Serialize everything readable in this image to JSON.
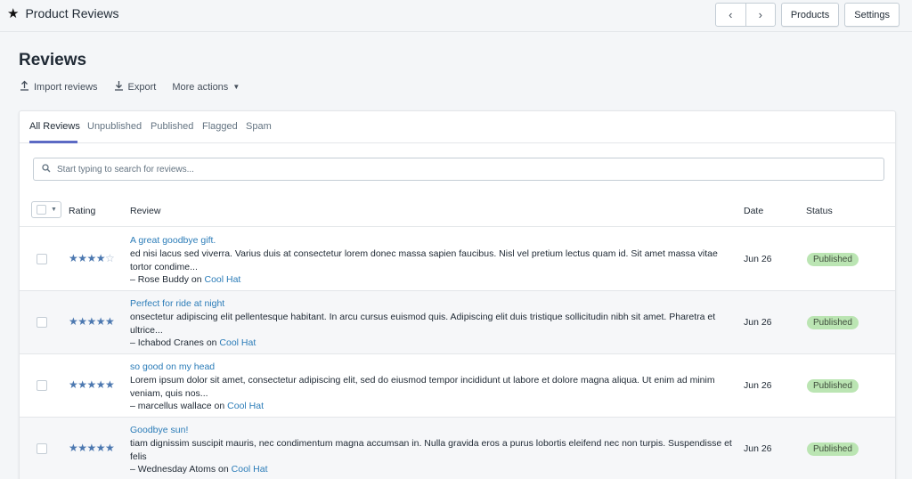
{
  "header": {
    "app_title": "Product Reviews",
    "app_icon": "star-icon",
    "prev_icon": "‹",
    "next_icon": "›",
    "products_label": "Products",
    "settings_label": "Settings"
  },
  "page": {
    "title": "Reviews",
    "actions": {
      "import_label": "Import reviews",
      "export_label": "Export",
      "more_label": "More actions"
    }
  },
  "tabs": [
    {
      "label": "All Reviews",
      "active": true
    },
    {
      "label": "Unpublished",
      "active": false
    },
    {
      "label": "Published",
      "active": false
    },
    {
      "label": "Flagged",
      "active": false
    },
    {
      "label": "Spam",
      "active": false
    }
  ],
  "search": {
    "placeholder": "Start typing to search for reviews...",
    "value": ""
  },
  "table": {
    "columns": {
      "rating": "Rating",
      "review": "Review",
      "date": "Date",
      "status": "Status"
    },
    "rows": [
      {
        "rating": 4,
        "title": "A great goodbye gift.",
        "body": "ed nisi lacus sed viverra. Varius duis at consectetur lorem donec massa sapien faucibus. Nisl vel pretium lectus quam id. Sit amet massa vitae tortor condime...",
        "author": "– Rose Buddy",
        "on": "on",
        "product": "Cool Hat",
        "date": "Jun 26",
        "status": "Published"
      },
      {
        "rating": 5,
        "title": "Perfect for ride at night",
        "body": "onsectetur adipiscing elit pellentesque habitant. In arcu cursus euismod quis. Adipiscing elit duis tristique sollicitudin nibh sit amet. Pharetra et ultrice...",
        "author": "– Ichabod Cranes",
        "on": "on",
        "product": "Cool Hat",
        "date": "Jun 26",
        "status": "Published"
      },
      {
        "rating": 5,
        "title": "so good on my head",
        "body": "Lorem ipsum dolor sit amet, consectetur adipiscing elit, sed do eiusmod tempor incididunt ut labore et dolore magna aliqua. Ut enim ad minim veniam, quis nos...",
        "author": "– marcellus wallace",
        "on": "on",
        "product": "Cool Hat",
        "date": "Jun 26",
        "status": "Published"
      },
      {
        "rating": 5,
        "title": "Goodbye sun!",
        "body": "tiam dignissim suscipit mauris, nec condimentum magna accumsan in. Nulla gravida eros a purus lobortis eleifend nec non turpis. Suspendisse et felis",
        "author": "– Wednesday Atoms",
        "on": "on",
        "product": "Cool Hat",
        "date": "Jun 26",
        "status": "Published"
      }
    ]
  },
  "colors": {
    "accent": "#5c6ac4",
    "link": "#2b7cb8",
    "star": "#4c78b0",
    "badge_bg": "#bbe5b3"
  }
}
